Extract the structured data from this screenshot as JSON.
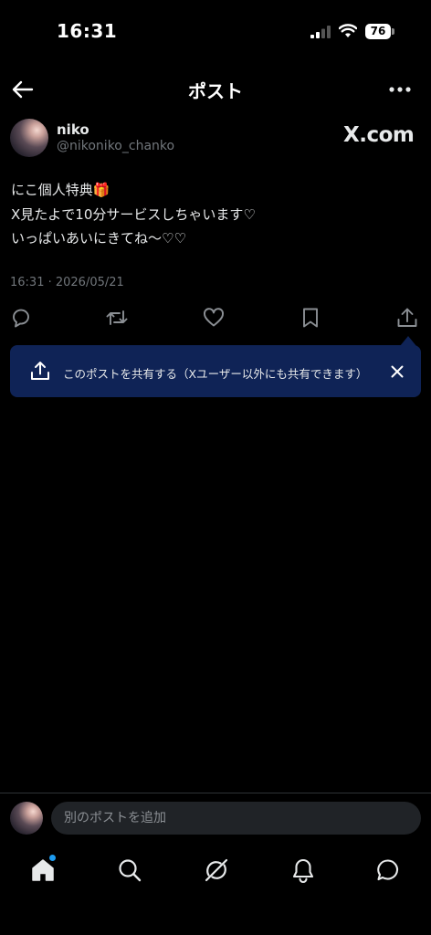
{
  "status_bar": {
    "time": "16:31",
    "battery": "76"
  },
  "header": {
    "title": "ポスト"
  },
  "author": {
    "name": "niko",
    "handle": "@nikoniko_chanko",
    "badge": "X.com"
  },
  "post": {
    "lines": [
      "にこ個人特典🎁",
      "X見たよで10分サービスしちゃいます♡",
      "いっぱいあいにきてね〜♡♡"
    ],
    "timestamp": "16:31 · 2026/05/21"
  },
  "actions": [
    "reply-icon",
    "repost-icon",
    "like-icon",
    "bookmark-icon",
    "share-icon"
  ],
  "share_tooltip": {
    "text": "このポストを共有する（Xユーザー以外にも共有できます）"
  },
  "composer": {
    "placeholder": "別のポストを追加"
  },
  "tabs": [
    "home-icon",
    "search-icon",
    "grok-icon",
    "notifications-icon",
    "messages-icon"
  ],
  "colors": {
    "background": "#000000",
    "tooltip": "#0f2356",
    "accent": "#1d9bf0",
    "muted": "#71767b"
  }
}
